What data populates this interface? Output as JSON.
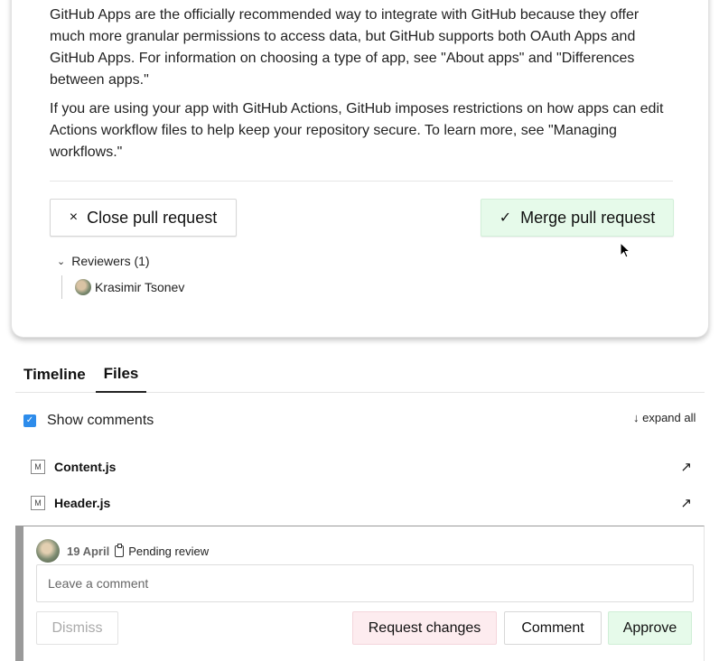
{
  "description": {
    "para1": "GitHub Apps are the officially recommended way to integrate with GitHub because they offer much more granular permissions to access data, but GitHub supports both OAuth Apps and GitHub Apps. For information on choosing a type of app, see \"About apps\" and \"Differences between apps.\"",
    "para2": "If you are using your app with GitHub Actions, GitHub imposes restrictions on how apps can edit Actions workflow files to help keep your repository secure. To learn more, see \"Managing workflows.\""
  },
  "actions": {
    "close_label": "Close pull request",
    "close_icon": "×",
    "merge_label": "Merge pull request",
    "merge_icon": "✓"
  },
  "reviewers": {
    "label": "Reviewers (1)",
    "list": [
      {
        "name": "Krasimir Tsonev"
      }
    ]
  },
  "tabs": [
    {
      "label": "Timeline"
    },
    {
      "label": "Files"
    }
  ],
  "options": {
    "show_comments": "Show comments",
    "expand_all": "↓ expand all"
  },
  "files": [
    {
      "status": "M",
      "name": "Content.js"
    },
    {
      "status": "M",
      "name": "Header.js"
    }
  ],
  "review": {
    "date": "19 April",
    "status": "Pending review",
    "placeholder": "Leave a comment",
    "dismiss_label": "Dismiss",
    "request_changes_label": "Request changes",
    "comment_label": "Comment",
    "approve_label": "Approve"
  },
  "colors": {
    "accent": "#2d8ceb",
    "merge_bg": "#e6faea",
    "request_changes_bg": "#fdecef"
  }
}
